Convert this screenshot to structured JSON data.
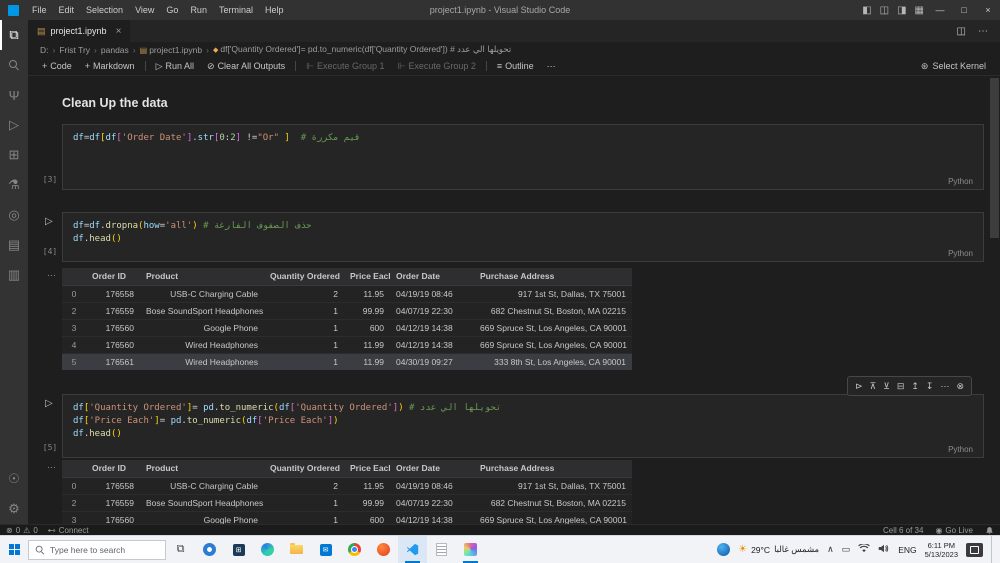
{
  "window": {
    "title": "project1.ipynb - Visual Studio Code",
    "menus": [
      "File",
      "Edit",
      "Selection",
      "View",
      "Go",
      "Run",
      "Terminal",
      "Help"
    ]
  },
  "tabbar": {
    "tab_label": "project1.ipynb",
    "close": "×"
  },
  "breadcrumb": {
    "items": [
      "D:",
      "Frist Try",
      "pandas",
      "project1.ipynb"
    ],
    "code": "df['Quantity Ordered']= pd.to_numeric(df['Quantity Ordered']) # تحويلها الي عدد"
  },
  "toolbar": {
    "code": "Code",
    "markdown": "Markdown",
    "run_all": "Run All",
    "clear": "Clear All Outputs",
    "group1": "Execute Group 1",
    "group2": "Execute Group 2",
    "outline": "Outline",
    "select_kernel": "Select Kernel"
  },
  "notebook": {
    "heading": "Clean Up the data",
    "cells": [
      {
        "exec": "[3]",
        "lang": "Python",
        "code": [
          [
            {
              "t": "df",
              "c": "v"
            },
            {
              "t": "=",
              "c": "o"
            },
            {
              "t": "df",
              "c": "v"
            },
            {
              "t": "[",
              "c": "b1"
            },
            {
              "t": "df",
              "c": "v"
            },
            {
              "t": "[",
              "c": "b2"
            },
            {
              "t": "'Order Date'",
              "c": "s"
            },
            {
              "t": "]",
              "c": "b2"
            },
            {
              "t": ".",
              "c": "o"
            },
            {
              "t": "str",
              "c": "v"
            },
            {
              "t": "[",
              "c": "b2"
            },
            {
              "t": "0",
              "c": "n"
            },
            {
              "t": ":",
              "c": "o"
            },
            {
              "t": "2",
              "c": "n"
            },
            {
              "t": "]",
              "c": "b2"
            },
            {
              "t": " !=",
              "c": "o"
            },
            {
              "t": "\"Or\"",
              "c": "s"
            },
            {
              "t": " ",
              "c": "o"
            },
            {
              "t": "]",
              "c": "b1"
            },
            {
              "t": "  ",
              "c": "o"
            },
            {
              "t": "# قيم مكررة",
              "c": "c"
            }
          ]
        ]
      },
      {
        "exec": "[4]",
        "lang": "Python",
        "code": [
          [
            {
              "t": "df",
              "c": "v"
            },
            {
              "t": "=",
              "c": "o"
            },
            {
              "t": "df",
              "c": "v"
            },
            {
              "t": ".",
              "c": "o"
            },
            {
              "t": "dropna",
              "c": "f"
            },
            {
              "t": "(",
              "c": "b1"
            },
            {
              "t": "how",
              "c": "v"
            },
            {
              "t": "=",
              "c": "o"
            },
            {
              "t": "'all'",
              "c": "s"
            },
            {
              "t": ")",
              "c": "b1"
            },
            {
              "t": " ",
              "c": "o"
            },
            {
              "t": "# حذف الصفوف الفارغة",
              "c": "c"
            }
          ],
          [
            {
              "t": "df",
              "c": "v"
            },
            {
              "t": ".",
              "c": "o"
            },
            {
              "t": "head",
              "c": "f"
            },
            {
              "t": "(",
              "c": "b1"
            },
            {
              "t": ")",
              "c": "b1"
            }
          ]
        ]
      },
      {
        "exec": "[5]",
        "lang": "Python",
        "code": [
          [
            {
              "t": "df",
              "c": "v"
            },
            {
              "t": "[",
              "c": "b1"
            },
            {
              "t": "'Quantity Ordered'",
              "c": "s"
            },
            {
              "t": "]",
              "c": "b1"
            },
            {
              "t": "= ",
              "c": "o"
            },
            {
              "t": "pd",
              "c": "v"
            },
            {
              "t": ".",
              "c": "o"
            },
            {
              "t": "to_numeric",
              "c": "f"
            },
            {
              "t": "(",
              "c": "b1"
            },
            {
              "t": "df",
              "c": "v"
            },
            {
              "t": "[",
              "c": "b2"
            },
            {
              "t": "'Quantity Ordered'",
              "c": "s"
            },
            {
              "t": "]",
              "c": "b2"
            },
            {
              "t": ")",
              "c": "b1"
            },
            {
              "t": " ",
              "c": "o"
            },
            {
              "t": "# تحويلها الي عدد",
              "c": "c"
            }
          ],
          [
            {
              "t": "df",
              "c": "v"
            },
            {
              "t": "[",
              "c": "b1"
            },
            {
              "t": "'Price Each'",
              "c": "s"
            },
            {
              "t": "]",
              "c": "b1"
            },
            {
              "t": "= ",
              "c": "o"
            },
            {
              "t": "pd",
              "c": "v"
            },
            {
              "t": ".",
              "c": "o"
            },
            {
              "t": "to_numeric",
              "c": "f"
            },
            {
              "t": "(",
              "c": "b1"
            },
            {
              "t": "df",
              "c": "v"
            },
            {
              "t": "[",
              "c": "b2"
            },
            {
              "t": "'Price Each'",
              "c": "s"
            },
            {
              "t": "]",
              "c": "b2"
            },
            {
              "t": ")",
              "c": "b1"
            }
          ],
          [
            {
              "t": "df",
              "c": "v"
            },
            {
              "t": ".",
              "c": "o"
            },
            {
              "t": "head",
              "c": "f"
            },
            {
              "t": "(",
              "c": "b1"
            },
            {
              "t": ")",
              "c": "b1"
            }
          ]
        ]
      }
    ],
    "table1": {
      "columns": [
        "",
        "Order ID",
        "Product",
        "Quantity Ordered",
        "Price Each",
        "Order Date",
        "Purchase Address"
      ],
      "rows": [
        {
          "cells": [
            "0",
            "176558",
            "USB-C Charging Cable",
            "2",
            "11.95",
            "04/19/19 08:46",
            "917 1st St, Dallas, TX 75001"
          ]
        },
        {
          "cells": [
            "2",
            "176559",
            "Bose SoundSport Headphones",
            "1",
            "99.99",
            "04/07/19 22:30",
            "682 Chestnut St, Boston, MA 02215"
          ]
        },
        {
          "cells": [
            "3",
            "176560",
            "Google Phone",
            "1",
            "600",
            "04/12/19 14:38",
            "669 Spruce St, Los Angeles, CA 90001"
          ]
        },
        {
          "cells": [
            "4",
            "176560",
            "Wired Headphones",
            "1",
            "11.99",
            "04/12/19 14:38",
            "669 Spruce St, Los Angeles, CA 90001"
          ]
        },
        {
          "cells": [
            "5",
            "176561",
            "Wired Headphones",
            "1",
            "11.99",
            "04/30/19 09:27",
            "333 8th St, Los Angeles, CA 90001"
          ],
          "selected": true
        }
      ]
    },
    "table2": {
      "columns": [
        "",
        "Order ID",
        "Product",
        "Quantity Ordered",
        "Price Each",
        "Order Date",
        "Purchase Address"
      ],
      "rows": [
        {
          "cells": [
            "0",
            "176558",
            "USB-C Charging Cable",
            "2",
            "11.95",
            "04/19/19 08:46",
            "917 1st St, Dallas, TX 75001"
          ]
        },
        {
          "cells": [
            "2",
            "176559",
            "Bose SoundSport Headphones",
            "1",
            "99.99",
            "04/07/19 22:30",
            "682 Chestnut St, Boston, MA 02215"
          ]
        },
        {
          "cells": [
            "3",
            "176560",
            "Google Phone",
            "1",
            "600",
            "04/12/19 14:38",
            "669 Spruce St, Los Angeles, CA 90001"
          ]
        }
      ]
    }
  },
  "statusbar": {
    "errors": "0",
    "warnings": "0",
    "connect": "Connect",
    "cell_position": "Cell 6 of 34",
    "go_live": "Go Live"
  },
  "taskbar": {
    "search_placeholder": "Type here to search",
    "weather_temp": "29°C",
    "weather_text": "مشمس غالبا",
    "language": "ENG",
    "time": "6:11 PM",
    "date": "5/13/2023"
  },
  "icons": {
    "explorer": "⧉",
    "source_control": "Ψ",
    "run_debug": "▷",
    "extensions": "⊞",
    "testing": "⚗",
    "jupyter": "◎",
    "notebook": "▤",
    "book": "▥",
    "account": "☉",
    "settings": "⚙",
    "layout_sidebar": "◧",
    "layout_panel": "◫",
    "layout_secondary": "◨",
    "layout_custom": "▦",
    "minimize": "—",
    "maximize": "□",
    "close": "×",
    "tab_file": "▤",
    "split_editor": "◫",
    "more": "⋯",
    "crumb_sep": "›",
    "symbol": "◆",
    "add": "+",
    "run": "▷",
    "clear": "⊘",
    "exec_group": "⊩",
    "outline": "≡",
    "kernel": "⊛",
    "out_more": "⋯",
    "tb_run_line": "⊳",
    "tb_exec_above": "⊼",
    "tb_exec_below": "⊻",
    "tb_split": "⊟",
    "tb_insert_above": "↥",
    "tb_insert_below": "↧",
    "tb_more": "⋯",
    "tb_delete": "⊗",
    "error": "⊗",
    "warning": "⚠",
    "connect": "⊷",
    "golive": "◉",
    "chevron_up": "∧",
    "keyboard": "▭",
    "sun": "☀",
    "envelope": "✉"
  },
  "colors": {
    "accent": "#0078d4",
    "editor_bg": "#1e1e1e",
    "titlebar_bg": "#323233",
    "activitybar_bg": "#333333",
    "cell_bg": "#252526",
    "table_header_bg": "#2e2e30",
    "selected_row_bg": "#3a3d41",
    "string": "#ce9178",
    "comment": "#6a9955",
    "variable": "#9cdcfe",
    "function": "#dcdcaa",
    "number": "#b5cea8",
    "bracket1": "#ffd700",
    "bracket2": "#da70d6",
    "taskbar_bg": "#f1f3f7"
  }
}
